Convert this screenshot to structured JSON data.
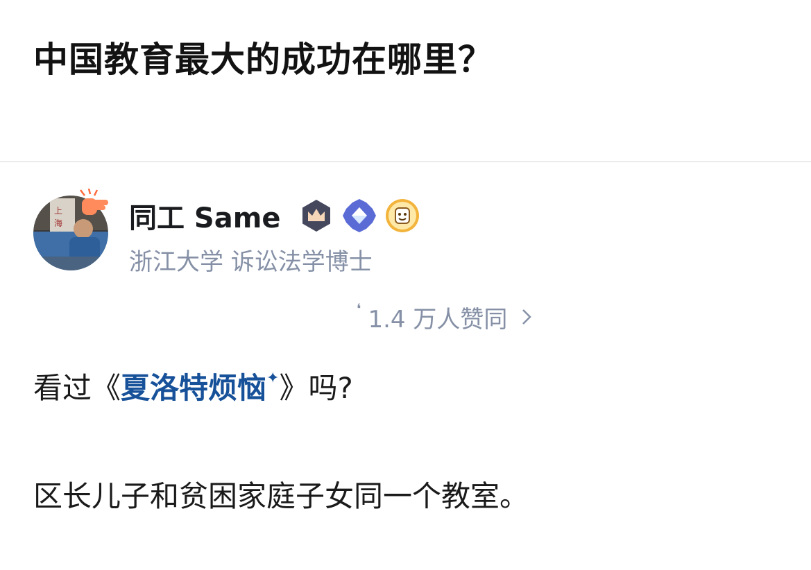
{
  "question": {
    "title": "中国教育最大的成功在哪里？"
  },
  "author": {
    "name": "同工 Same",
    "bio": "浙江大学 诉讼法学博士",
    "badges": [
      "crown-badge",
      "diamond-badge",
      "mascot-badge"
    ]
  },
  "votes": {
    "text": "1.4 万人赞同"
  },
  "answer": {
    "p1_prefix": "看过《",
    "book_title": "夏洛特烦恼",
    "p1_suffix": "》吗?",
    "p2": "区长儿子和贫困家庭子女同一个教室。"
  },
  "colors": {
    "link": "#175199",
    "muted": "#8590a6",
    "badge_dark": "#45475d",
    "badge_blue": "#5b6bd6",
    "badge_gold": "#f2b43c"
  }
}
